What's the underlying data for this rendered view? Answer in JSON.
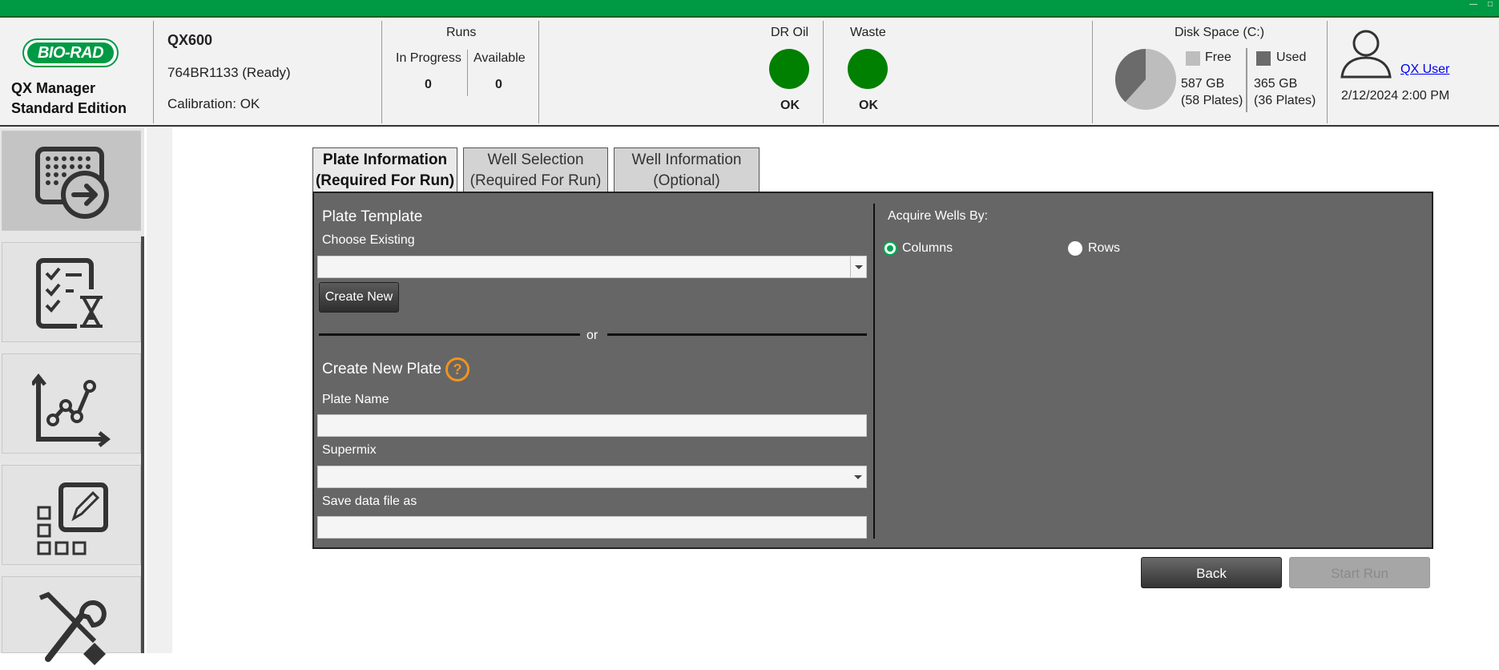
{
  "colors": {
    "brand_green": "#009a44",
    "status_ok": "#008000",
    "panel_bg": "#666666",
    "help_orange": "#f0941d"
  },
  "app": {
    "logo_text": "BIO-RAD",
    "name_line1": "QX Manager",
    "name_line2": "Standard Edition"
  },
  "instrument": {
    "model": "QX600",
    "serial": "764BR1133 (Ready)",
    "calibration": "Calibration: OK"
  },
  "runs": {
    "title": "Runs",
    "in_progress_label": "In Progress",
    "in_progress_value": "0",
    "available_label": "Available",
    "available_value": "0"
  },
  "consumables": [
    {
      "label": "DR Oil",
      "status": "OK"
    },
    {
      "label": "Waste",
      "status": "OK"
    }
  ],
  "disk": {
    "title": "Disk Space (C:)",
    "free_label": "Free",
    "free_value": "587 GB",
    "free_plates": "(58 Plates)",
    "used_label": "Used",
    "used_value": "365 GB",
    "used_plates": "(36 Plates)",
    "used_fraction": 0.383
  },
  "user": {
    "name": "QX User",
    "datetime": "2/12/2024 2:00 PM"
  },
  "nav": [
    {
      "icon": "plate-run-icon"
    },
    {
      "icon": "checklist-timer-icon"
    },
    {
      "icon": "analysis-chart-icon"
    },
    {
      "icon": "plate-editor-icon"
    },
    {
      "icon": "tools-icon"
    }
  ],
  "tabs": [
    {
      "line1": "Plate Information",
      "line2": "(Required For Run)"
    },
    {
      "line1": "Well Selection",
      "line2": "(Required For Run)"
    },
    {
      "line1": "Well Information",
      "line2": "(Optional)"
    }
  ],
  "form": {
    "plate_template_heading": "Plate Template",
    "choose_existing_label": "Choose Existing",
    "choose_existing_value": "",
    "create_new_button": "Create New",
    "or_text": "or",
    "create_new_plate_heading": "Create New Plate",
    "help_symbol": "?",
    "plate_name_label": "Plate Name",
    "plate_name_value": "",
    "supermix_label": "Supermix",
    "supermix_value": "",
    "save_data_label": "Save data file as",
    "save_data_value": ""
  },
  "acquire": {
    "label": "Acquire Wells By:",
    "option_columns": "Columns",
    "option_rows": "Rows",
    "selected": "Columns"
  },
  "footer": {
    "back_label": "Back",
    "start_label": "Start Run"
  }
}
